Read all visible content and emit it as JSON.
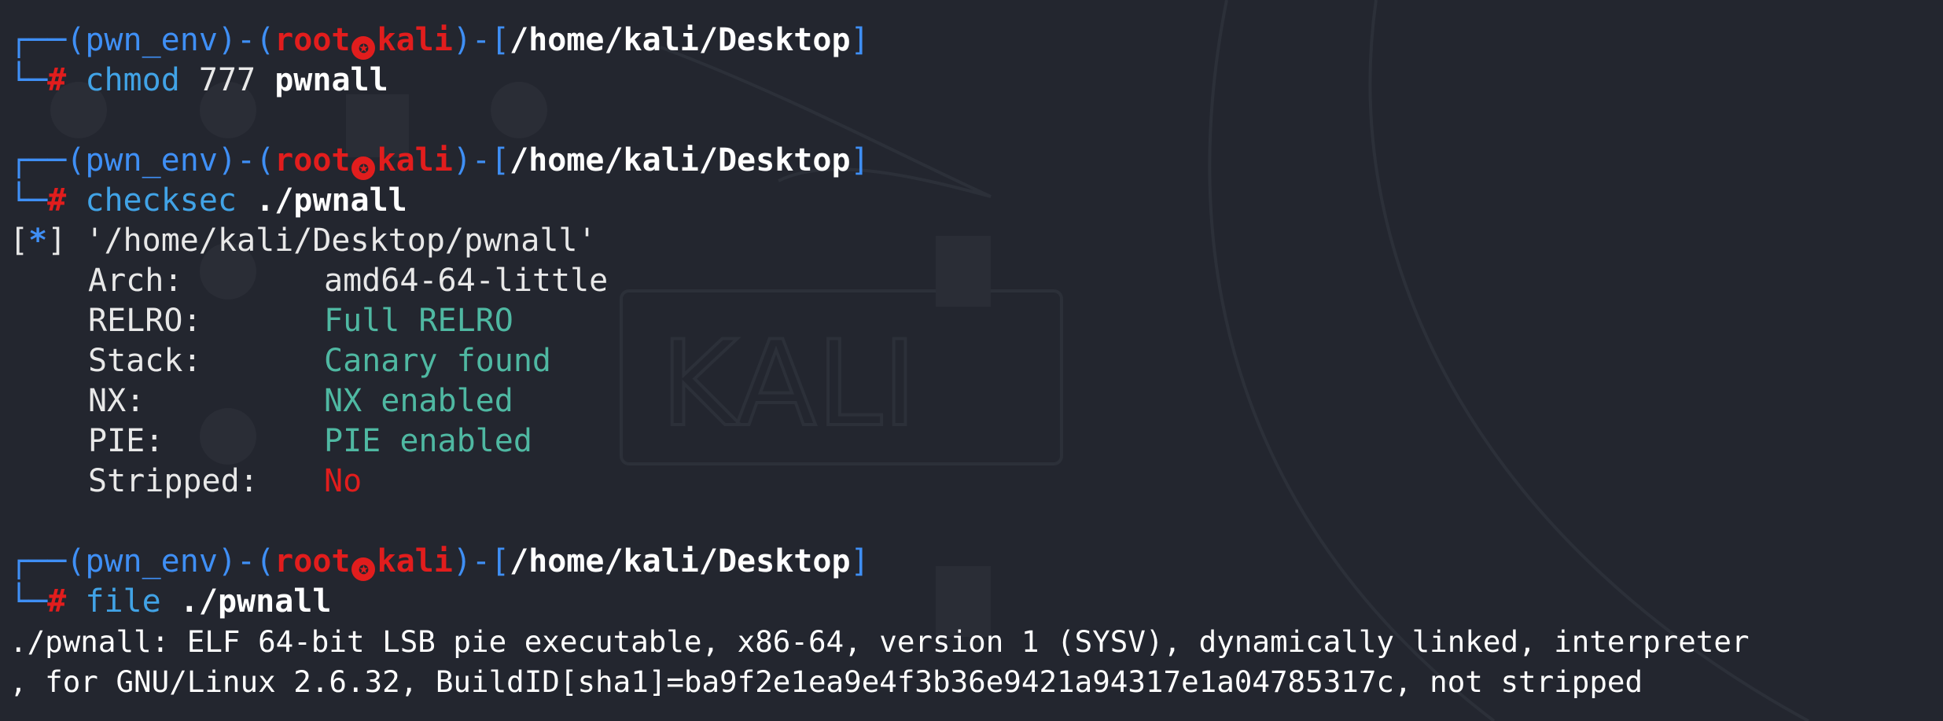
{
  "prompt": {
    "env": "pwn_env",
    "user": "root",
    "user_icon": "kali-skull-icon",
    "host": "kali",
    "path": "/home/kali/Desktop",
    "symbol": "#"
  },
  "commands": [
    {
      "cmd": "chmod",
      "args_plain": "777",
      "args_bold": "pwnall"
    },
    {
      "cmd": "checksec",
      "args_plain": "",
      "args_bold": "./pwnall"
    },
    {
      "cmd": "file",
      "args_plain": "",
      "args_bold": "./pwnall"
    }
  ],
  "checksec": {
    "marker": "*",
    "target": "'/home/kali/Desktop/pwnall'",
    "rows": [
      {
        "key": "Arch:",
        "value": "amd64-64-little"
      },
      {
        "key": "RELRO:",
        "value": "Full RELRO"
      },
      {
        "key": "Stack:",
        "value": "Canary found"
      },
      {
        "key": "NX:",
        "value": "NX enabled"
      },
      {
        "key": "PIE:",
        "value": "PIE enabled"
      },
      {
        "key": "Stripped:",
        "value": "No"
      }
    ]
  },
  "file_output": {
    "line1": "./pwnall: ELF 64-bit LSB pie executable, x86-64, version 1 (SYSV), dynamically linked, interpreter",
    "line2": ", for GNU/Linux 2.6.32, BuildID[sha1]=ba9f2e1ea9e4f3b36e9421a94317e1a04785317c, not stripped"
  },
  "colors": {
    "background": "#23262f",
    "prompt_blue": "#3f8ff5",
    "root_red": "#e11d1d",
    "green_value": "#4fb8a2",
    "command_cyan": "#41a3e6"
  }
}
